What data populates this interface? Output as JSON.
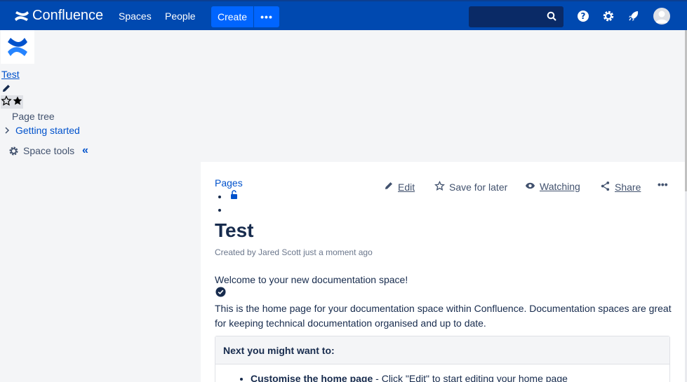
{
  "header": {
    "brand": "Confluence",
    "nav": [
      "Spaces",
      "People"
    ],
    "create_label": "Create",
    "more_label": "•••"
  },
  "sidebar": {
    "space_name": "Test",
    "page_tree_title": "Page tree",
    "tree_items": [
      "Getting started"
    ],
    "space_tools_label": "Space tools",
    "collapse_label": "«"
  },
  "page": {
    "breadcrumb": "Pages",
    "actions": {
      "edit": "Edit",
      "save": "Save for later",
      "watching": "Watching",
      "share": "Share",
      "more": "•••"
    },
    "title": "Test",
    "byline": "Created by Jared Scott just a moment ago",
    "welcome": "Welcome to your new documentation space!",
    "paragraph": "This is the home page for your documentation space within Confluence. Documentation spaces are great for keeping technical documentation organised and up to date.",
    "panel": {
      "heading": "Next you might want to:",
      "item_bold": "Customise the home page",
      "item_rest": " - Click \"Edit\" to start editing your home page"
    }
  },
  "colors": {
    "topbar": "#0049b0",
    "create": "#0065ff",
    "link": "#0052cc",
    "text": "#172b4d"
  }
}
